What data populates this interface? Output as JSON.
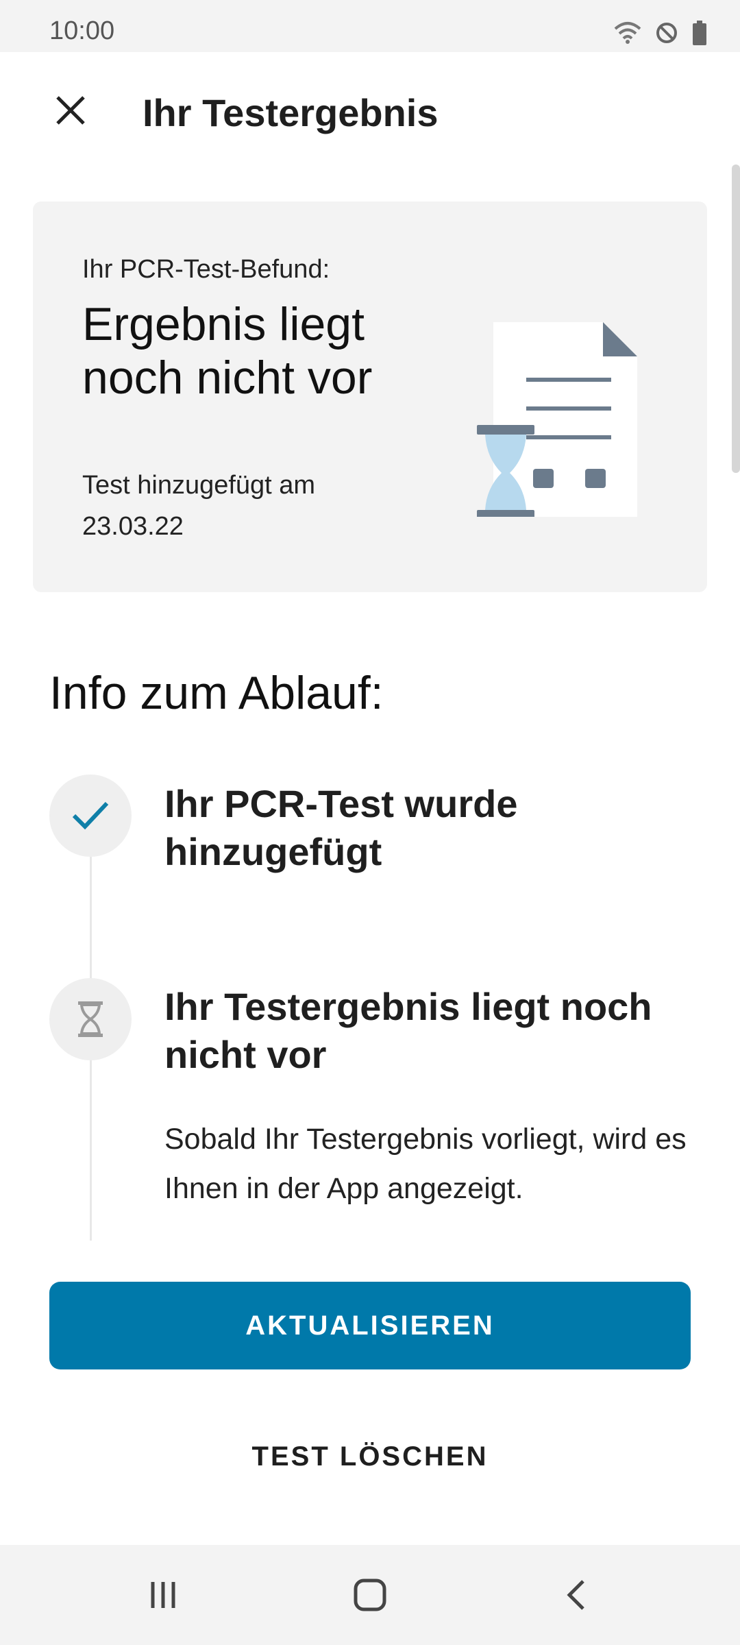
{
  "status_bar": {
    "time": "10:00",
    "icons": [
      "wifi-icon",
      "do-not-disturb-icon",
      "battery-icon"
    ]
  },
  "app_bar": {
    "title": "Ihr Testergebnis",
    "close_icon": "close-icon"
  },
  "result_card": {
    "label": "Ihr PCR-Test-Befund:",
    "title": "Ergebnis liegt noch nicht vor",
    "date_text": "Test hinzugefügt am 23.03.22",
    "illustration": "pending-document-hourglass"
  },
  "info": {
    "heading": "Info zum Ablauf:",
    "steps": [
      {
        "icon": "check-icon",
        "title": "Ihr PCR-Test wurde hinzugefügt",
        "description": ""
      },
      {
        "icon": "hourglass-icon",
        "title": "Ihr Testergebnis liegt noch nicht vor",
        "description": "Sobald Ihr Testergebnis vorliegt, wird es Ihnen in der App angezeigt."
      }
    ]
  },
  "actions": {
    "primary": "AKTUALISIEREN",
    "secondary": "TEST LÖSCHEN"
  },
  "nav_bar": {
    "items": [
      "recent-apps-icon",
      "home-icon",
      "back-icon"
    ]
  },
  "colors": {
    "accent": "#0079aa",
    "card_background": "#f3f3f3",
    "check": "#0f7fa8",
    "illustration_slate": "#6b7b8c",
    "hourglass_sand": "#b7d9ee"
  }
}
